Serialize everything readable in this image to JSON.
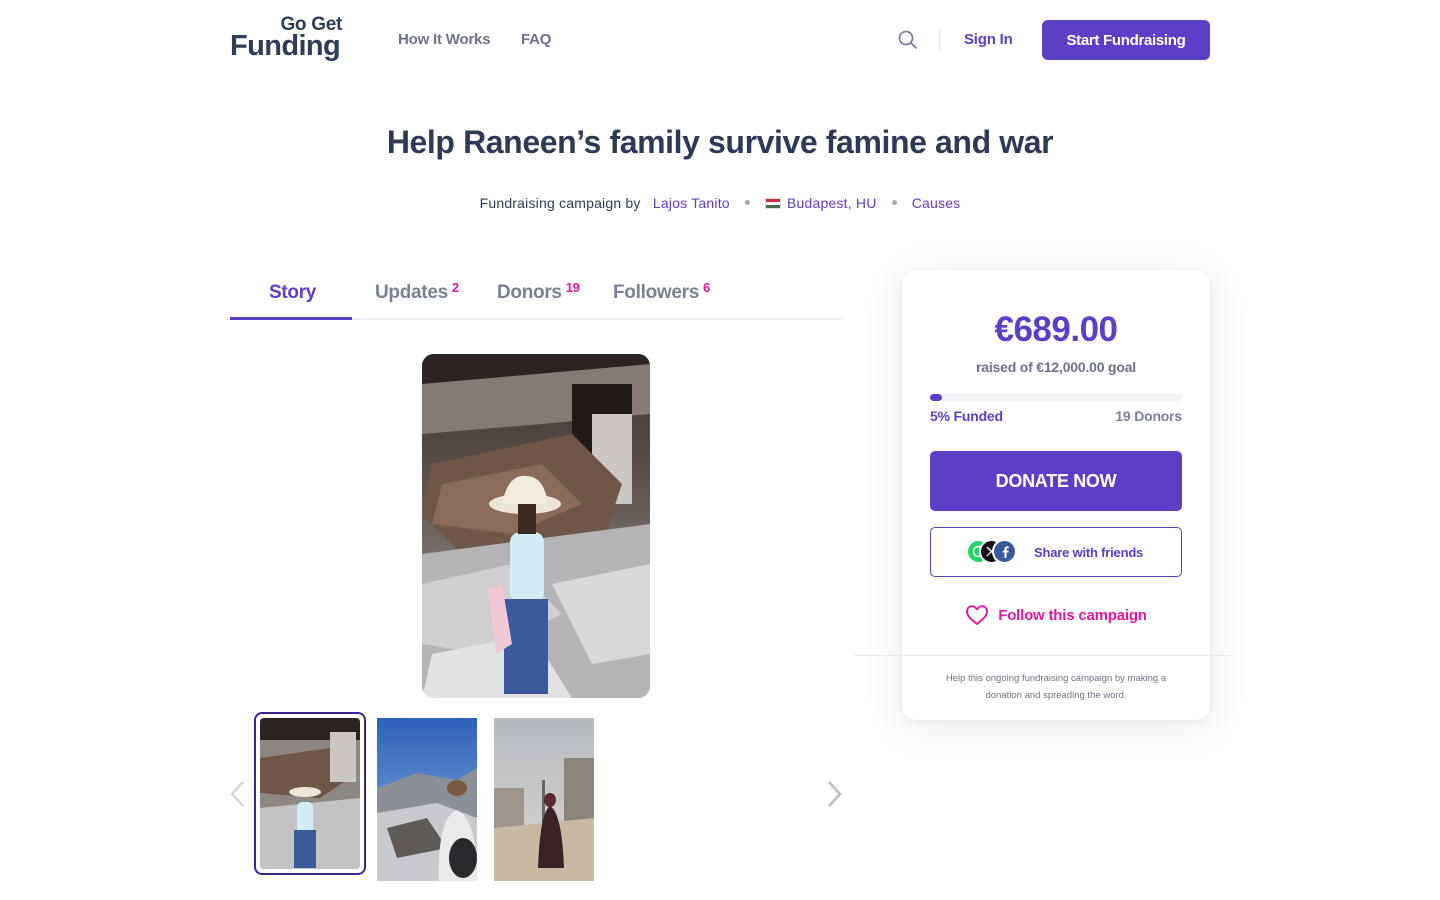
{
  "header": {
    "logo_top": "Go Get",
    "logo_bottom": "Funding",
    "nav": [
      "How It Works",
      "FAQ"
    ],
    "sign_in": "Sign In",
    "start_fundraising": "Start Fundraising",
    "search_icon": "search-icon"
  },
  "campaign": {
    "title": "Help Raneen’s family survive famine and war",
    "byline_prefix": "Fundraising campaign by",
    "organizer": "Lajos Tanito",
    "location": "Budapest, HU",
    "category": "Causes"
  },
  "tabs": [
    {
      "label": "Story",
      "count": ""
    },
    {
      "label": "Updates",
      "count": "2"
    },
    {
      "label": "Donors",
      "count": "19"
    },
    {
      "label": "Followers",
      "count": "6"
    }
  ],
  "gallery": {
    "selected_index": 0,
    "thumbnail_count": 3
  },
  "donation_card": {
    "amount_raised": "€689.00",
    "goal_text": "raised of €12,000.00 goal",
    "progress_fraction": 0.05,
    "funded_text": "5% Funded",
    "donors_text": "19 Donors",
    "donate_label": "DONATE NOW",
    "share_label": "Share with friends",
    "follow_label": "Follow this campaign",
    "help_text": "Help this ongoing fundraising campaign by making a donation and spreading the word."
  },
  "colors": {
    "brand_purple": "#5b3fc6",
    "accent_pink": "#e0189b",
    "text_dark": "#2e3a55"
  }
}
